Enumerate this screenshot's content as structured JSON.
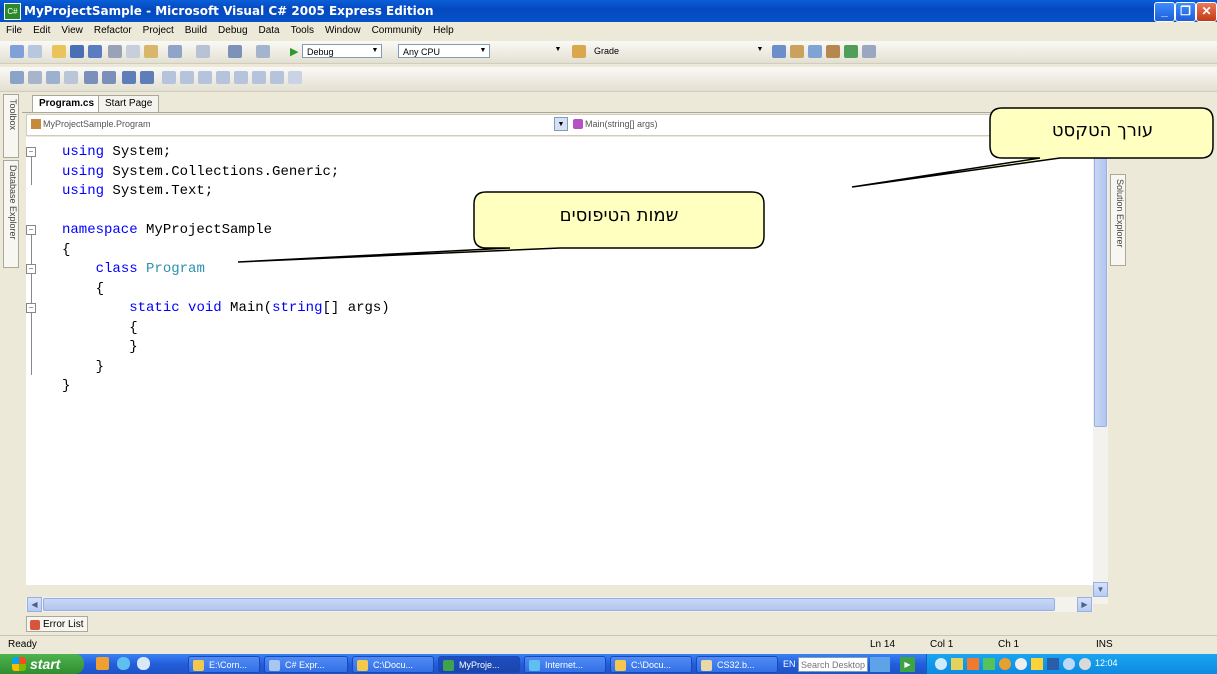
{
  "window": {
    "title": "MyProjectSample - Microsoft Visual C# 2005 Express Edition",
    "app_icon": "csharp-app-icon"
  },
  "menu": [
    "File",
    "Edit",
    "View",
    "Refactor",
    "Project",
    "Build",
    "Debug",
    "Data",
    "Tools",
    "Window",
    "Community",
    "Help"
  ],
  "toolbar": {
    "config_combo": "Debug",
    "platform_combo": "Any CPU",
    "find_combo": "Grade"
  },
  "side_tabs": {
    "toolbox": "Toolbox",
    "database_explorer": "Database Explorer",
    "solution_explorer": "Solution Explorer"
  },
  "doc_tabs": [
    {
      "label": "Program.cs",
      "active": true
    },
    {
      "label": "Start Page",
      "active": false
    }
  ],
  "navbar": {
    "types": "MyProjectSample.Program",
    "members": "Main(string[] args)"
  },
  "code_lines": [
    "using System;",
    "using System.Collections.Generic;",
    "using System.Text;",
    "",
    "namespace MyProjectSample",
    "{",
    "    class Program",
    "    {",
    "        static void Main(string[] args)",
    "        {",
    "        }",
    "    }",
    "}"
  ],
  "bottom": {
    "error_list": "Error List"
  },
  "status": {
    "ready": "Ready",
    "ln": "Ln 14",
    "col": "Col 1",
    "ch": "Ch 1",
    "ins": "INS"
  },
  "taskbar": {
    "start": "start",
    "tasks": [
      "E:\\Corn...",
      "C# Expr...",
      "C:\\Docu...",
      "MyProje...",
      "Internet...",
      "C:\\Docu...",
      "CS32.b..."
    ],
    "lang": "EN",
    "search_placeholder": "Search Desktop",
    "clock": "12:04"
  },
  "callouts": {
    "text_editor": "עורך הטקסט",
    "type_names": "שמות הטיפוסים"
  },
  "colors": {
    "keyword": "#0000FF",
    "type": "#2B91AF",
    "callout_fill": "#FFFFC0"
  }
}
